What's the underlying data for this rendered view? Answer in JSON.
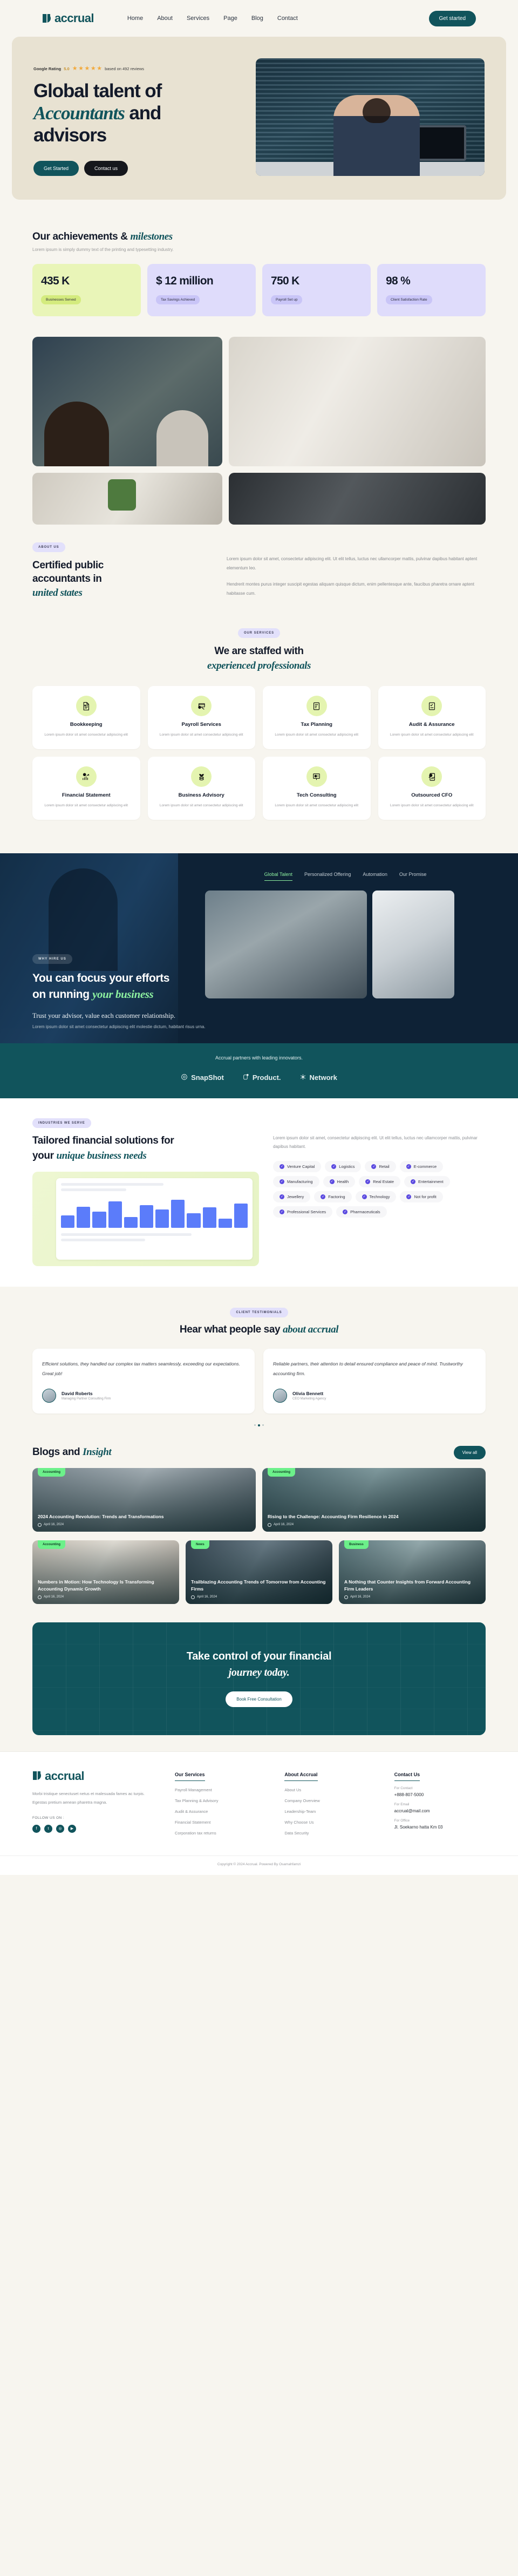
{
  "brand": {
    "name": "accrual",
    "logo_icon": "accrual-logo-mark"
  },
  "nav": {
    "links": [
      "Home",
      "About",
      "Services",
      "Page",
      "Blog",
      "Contact"
    ],
    "cta": "Get started"
  },
  "hero": {
    "rating_label": "Google Rating",
    "rating_score": "5.0",
    "rating_reviews": "based on 492 reviews",
    "title_line1": "Global talent of",
    "title_em": "Accountants",
    "title_line2_rest": " and",
    "title_line3": "advisors",
    "btn_primary": "Get Started",
    "btn_secondary": "Contact us"
  },
  "achievements": {
    "title_plain": "Our achievements &",
    "title_em": "milestones",
    "subtitle": "Lorem ipsum is simply dummy text of the printing and typesetting industry.",
    "stats": [
      {
        "value": "435 K",
        "label": "Businesses Served",
        "tone": "lime"
      },
      {
        "value": "$ 12 million",
        "label": "Tax Savings Achieved",
        "tone": "lilac"
      },
      {
        "value": "750 K",
        "label": "Payroll Set up",
        "tone": "lilac"
      },
      {
        "value": "98 %",
        "label": "Client Satisfaction Rate",
        "tone": "lilac"
      }
    ]
  },
  "about": {
    "badge": "ABOUT US",
    "title_line1": "Certified public",
    "title_line2": "accountants in",
    "title_em": "united states",
    "para1": "Lorem ipsum dolor sit amet, consectetur adipiscing elit. Ut elit tellus, luctus nec ullamcorper mattis, pulvinar dapibus habitant aptent elementum leo.",
    "para2": "Hendrerit montes purus integer suscipit egestas aliquam quisque dictum, enim pellentesque ante, faucibus pharetra ornare aptent habitasse cum."
  },
  "services": {
    "badge": "OUR SERVICES",
    "title_plain": "We are staffed with",
    "title_em": "experienced professionals",
    "desc": "Lorem ipsum dolor sit amet consectetur adipiscing elit",
    "items": [
      {
        "name": "Bookkeeping",
        "icon": "document-signed-icon"
      },
      {
        "name": "Payroll Services",
        "icon": "card-payment-icon"
      },
      {
        "name": "Tax Planning",
        "icon": "tax-document-icon"
      },
      {
        "name": "Audit & Assurance",
        "icon": "audit-checklist-icon"
      },
      {
        "name": "Financial Statement",
        "icon": "growth-chart-icon"
      },
      {
        "name": "Business Advisory",
        "icon": "plant-coins-icon"
      },
      {
        "name": "Tech Consulting",
        "icon": "presentation-chart-icon"
      },
      {
        "name": "Outsourced CFO",
        "icon": "magnify-report-icon"
      }
    ]
  },
  "why": {
    "badge": "WHY HIRE US",
    "title_line1": "You can focus your efforts",
    "title_line2_plain": "on running ",
    "title_em": "your business",
    "tabs": [
      "Global Talent",
      "Personalized Offering",
      "Automation",
      "Our Promise"
    ],
    "active_tab": "Global Talent",
    "caption": "Trust your advisor, value each customer relationship.",
    "caption_sub": "Lorem ipsum dolor sit amet consectetur adipiscing elit molestie dictum, habitant  risus urna."
  },
  "partners": {
    "title": "Accrual partners with leading innovators.",
    "logos": [
      {
        "name": "SnapShot",
        "icon": "snapshot-logo-icon"
      },
      {
        "name": "Product.",
        "icon": "product-logo-icon"
      },
      {
        "name": "Network",
        "icon": "network-logo-icon"
      }
    ]
  },
  "industries": {
    "badge": "INDUSTRIES WE SERVE",
    "title_plain": "Tailored financial solutions for",
    "title_line2_plain": "your ",
    "title_em": "unique business needs",
    "desc": "Lorem ipsum dolor sit amet, consectetur adipiscing elit. Ut elit tellus, luctus nec ullamcorper mattis, pulvinar dapibus habitant.",
    "tags": [
      "Venture Capital",
      "Logistics",
      "Retail",
      "E-commerce",
      "Manufacturing",
      "Health",
      "Real Estate",
      "Entertainment",
      "Jewellery",
      "Factoring",
      "Technology",
      "Not for profit",
      "Professional Services",
      "Pharmaceuticals"
    ]
  },
  "testimonials": {
    "badge": "CLIENT TESTIMONIALS",
    "title_plain": "Hear what people say ",
    "title_em": "about accrual",
    "items": [
      {
        "quote": "Efficient solutions, they handled our complex tax matters seamlessly, exceeding our expectations. Great job!",
        "name": "David Roberts",
        "role": "Managing Partner Consulting Firm"
      },
      {
        "quote": "Reliable partners, their attention to detail ensured compliance and peace of mind. Trustworthy accounting firm.",
        "name": "Olivia Bennett",
        "role": "CEO Marketing Agency"
      }
    ]
  },
  "blogs": {
    "title_plain": "Blogs and ",
    "title_em": "Insight",
    "view_all": "View all",
    "posts": [
      {
        "tag": "Accounting",
        "title": "2024 Accounting Revolution: Trends and Transformations",
        "date": "April 16, 2024"
      },
      {
        "tag": "Accounting",
        "title": "Rising to the Challenge: Accounting Firm Resilience in 2024",
        "date": "April 16, 2024"
      },
      {
        "tag": "Accounting",
        "title": "Numbers in Motion: How Technology Is Transforming Accounting Dynamic Growth",
        "date": "April 16, 2024"
      },
      {
        "tag": "News",
        "title": "Trailblazing Accounting Trends of Tomorrow from Accounting Firms",
        "date": "April 16, 2024"
      },
      {
        "tag": "Business",
        "title": "A Nothing that Counter Insights from Forward Accounting Firm Leaders",
        "date": "April 16, 2024"
      }
    ]
  },
  "cta": {
    "line1": "Take control of your financial",
    "line2_em": "journey today.",
    "button": "Book Free Consultation"
  },
  "footer": {
    "desc": "Morbi tristique senectuset netus et malesuada fames ac turpis. Egestas pretium aenean pharetra magna.",
    "follow_label": "FOLLOW US ON :",
    "socials": [
      {
        "name": "facebook-icon",
        "glyph": "f"
      },
      {
        "name": "twitter-icon",
        "glyph": "t"
      },
      {
        "name": "instagram-icon",
        "glyph": "◎"
      },
      {
        "name": "youtube-icon",
        "glyph": "▶"
      }
    ],
    "col_services_title": "Our Services",
    "col_services": [
      "Payroll Management",
      "Tax Planning & Advisory",
      "Audit & Assurance",
      "Financial Statement",
      "Corporation tax returns"
    ],
    "col_about_title": "About Accrual",
    "col_about": [
      "About Us",
      "Company Overview",
      "Leadership-Team",
      "Why Choose Us",
      "Data Security"
    ],
    "col_contact_title": "Contact Us",
    "contact_phone_label": "For Contact",
    "contact_phone": "+888-807-5000",
    "contact_email_label": "For Email",
    "contact_email": "accrual@mail.com",
    "contact_office_label": "For Office",
    "contact_office": "Jl. Soekarno hatta Km 03",
    "copyright": "Copyright © 2024 Accrual. Powered By Osamahfamzi"
  }
}
